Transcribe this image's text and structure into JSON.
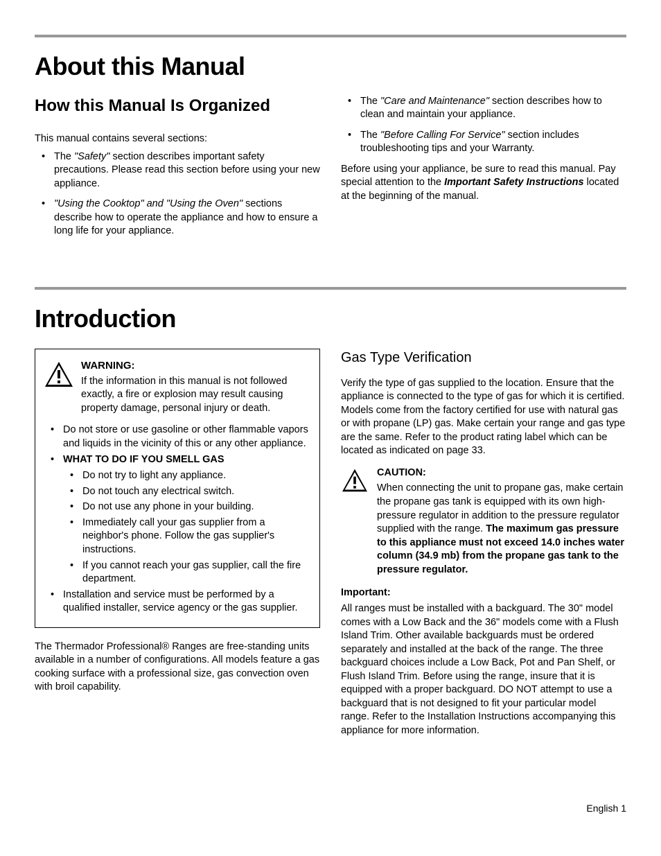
{
  "section1": {
    "title": "About this Manual",
    "subtitle": "How this Manual Is Organized",
    "intro": "This manual contains several sections:",
    "leftBullets": [
      {
        "pre": "The ",
        "em": "\"Safety\"",
        "post": " section describes important safety precautions. Please read this section before using your new appliance."
      },
      {
        "pre": "",
        "em": "\"Using the Cooktop\" and \"Using the Oven\"",
        "post": " sections describe how to operate the appliance and how to ensure a long life for your appliance."
      }
    ],
    "rightBullets": [
      {
        "pre": "The ",
        "em": "\"Care and Maintenance\"",
        "post": " section describes how to clean and maintain your appliance."
      },
      {
        "pre": "The ",
        "em": "\"Before Calling For Service\"",
        "post": " section includes troubleshooting tips and your Warranty."
      }
    ],
    "closingPre": "Before using your appliance, be sure to read this manual. Pay special attention to the ",
    "closingEm": "Important Safety Instructions",
    "closingPost": " located at the beginning of the manual."
  },
  "section2": {
    "title": "Introduction",
    "warning": {
      "label": "WARNING:",
      "body": "If the information in this manual is not followed exactly, a fire or explosion may result causing property damage, personal injury or death.",
      "b1": "Do not store or use gasoline or other flammable vapors and liquids in the vicinity of this or any other appliance.",
      "b2": "WHAT TO DO IF YOU SMELL GAS",
      "sub": [
        "Do not try to light any appliance.",
        "Do not touch any electrical switch.",
        "Do not use any phone in your building.",
        "Immediately call your gas supplier from a neighbor's phone. Follow the gas supplier's instructions.",
        "If you cannot reach your gas supplier, call the fire department."
      ],
      "b3": "Installation and service must be performed by a qualified installer, service agency or the gas supplier."
    },
    "introPara": "The Thermador Professional® Ranges are free-standing units available in a number of configurations. All models feature a gas cooking surface with a professional size, gas convection oven with broil capability.",
    "gasHeading": "Gas Type Verification",
    "gasPara": "Verify the type of gas supplied to the location. Ensure that the appliance is connected to the type of gas for which it is certified. Models come from the factory certified for use with natural gas or with propane (LP) gas. Make certain your range and gas type are the same. Refer to the product rating label which can be located as indicated on page 33.",
    "caution": {
      "label": "CAUTION:",
      "pre": "When connecting the unit to propane gas, make certain the propane gas tank is equipped with its own high-pressure regulator in addition to the pressure regulator supplied with the range. ",
      "bold": "The maximum gas pressure to this appliance must not exceed 14.0 inches water column (34.9 mb) from the propane gas tank to the pressure regulator."
    },
    "important": {
      "label": "Important:",
      "body": "All ranges must be installed with a backguard. The 30\" model comes with a Low Back and the 36\" models come with a Flush Island Trim. Other available backguards must be ordered separately and installed at the back of the range. The three backguard choices include a Low Back, Pot and Pan Shelf, or Flush Island Trim. Before using the range, insure that it is equipped with a proper backguard. DO NOT attempt to use a backguard that is not designed to fit your particular model range. Refer to the Installation Instructions accompanying this appliance for more information."
    }
  },
  "footer": "English 1"
}
